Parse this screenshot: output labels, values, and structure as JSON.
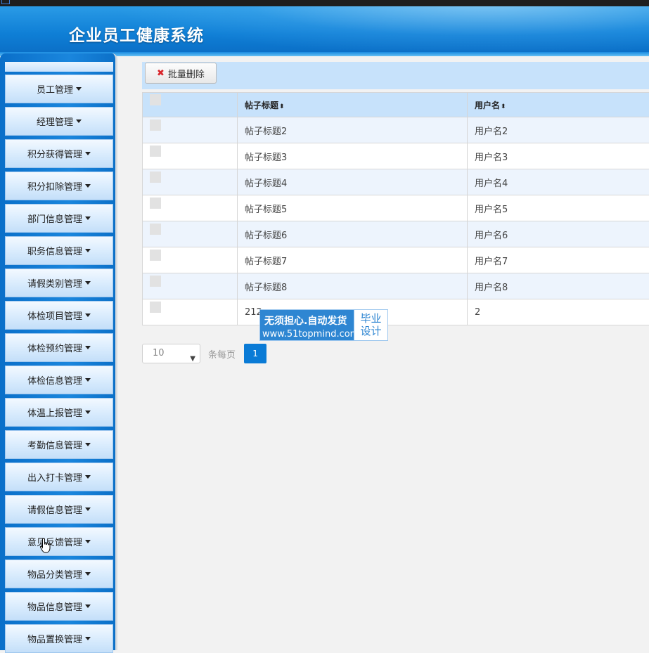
{
  "app": {
    "title": "企业员工健康系统"
  },
  "sidebar": {
    "items": [
      {
        "label": "员工管理"
      },
      {
        "label": "经理管理"
      },
      {
        "label": "积分获得管理"
      },
      {
        "label": "积分扣除管理"
      },
      {
        "label": "部门信息管理"
      },
      {
        "label": "职务信息管理"
      },
      {
        "label": "请假类别管理"
      },
      {
        "label": "体检项目管理"
      },
      {
        "label": "体检预约管理"
      },
      {
        "label": "体检信息管理"
      },
      {
        "label": "体温上报管理"
      },
      {
        "label": "考勤信息管理"
      },
      {
        "label": "出入打卡管理"
      },
      {
        "label": "请假信息管理"
      },
      {
        "label": "意见反馈管理"
      },
      {
        "label": "物品分类管理"
      },
      {
        "label": "物品信息管理"
      },
      {
        "label": "物品置换管理"
      }
    ]
  },
  "toolbar": {
    "batch_delete_label": "批量删除",
    "batch_delete_icon": "close-icon"
  },
  "table": {
    "columns": [
      "帖子标题",
      "用户名"
    ],
    "rows": [
      [
        "帖子标题2",
        "用户名2"
      ],
      [
        "帖子标题3",
        "用户名3"
      ],
      [
        "帖子标题4",
        "用户名4"
      ],
      [
        "帖子标题5",
        "用户名5"
      ],
      [
        "帖子标题6",
        "用户名6"
      ],
      [
        "帖子标题7",
        "用户名7"
      ],
      [
        "帖子标题8",
        "用户名8"
      ],
      [
        "212",
        "2"
      ]
    ]
  },
  "pager": {
    "page_size": "10",
    "per_page_label": "条每页",
    "current_page": "1"
  },
  "watermark": {
    "line1": "无须担心.自动发货",
    "line2": "www.51topmind.com",
    "badge_line1": "毕业",
    "badge_line2": "设计"
  },
  "colors": {
    "accent": "#0a7bd6",
    "header": "#0f7fd6",
    "table_header": "#c7e2fb"
  }
}
